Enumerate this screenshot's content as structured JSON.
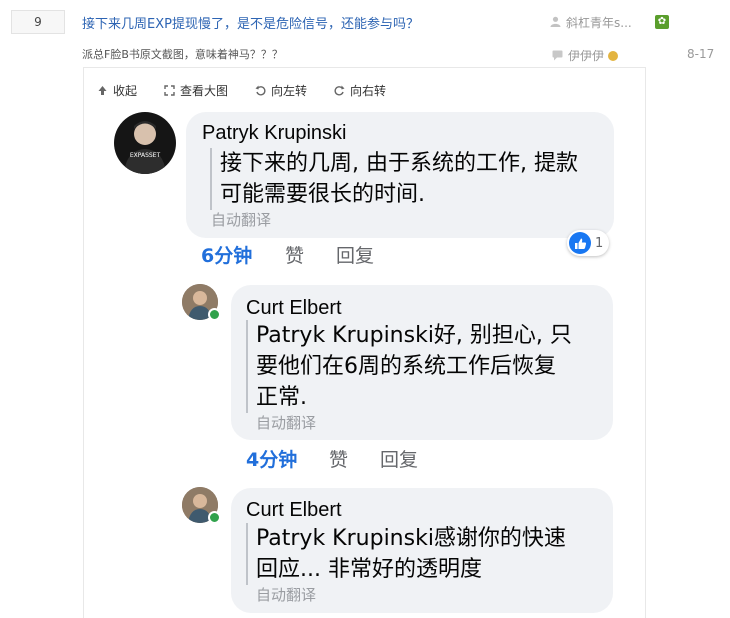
{
  "thread": {
    "reply_count": "9",
    "title": "接下来几周EXP提现慢了，是不是危险信号，还能参与吗？",
    "author": "斜杠青年s...",
    "summary": "派总F脸B书原文截图，意味着神马？？？",
    "last_replier": "伊伊伊",
    "date": "8-17"
  },
  "viewer_toolbar": {
    "collapse": "收起",
    "view_full": "查看大图",
    "rotate_left": "向左转",
    "rotate_right": "向右转"
  },
  "comments": [
    {
      "author": "Patryk Krupinski",
      "avatar_text": "EXPASSET",
      "lines": [
        "接下来的几周, 由于系统的工作, 提款",
        "可能需要很长的时间."
      ],
      "translate": "自动翻译",
      "time": "6分钟",
      "like": "赞",
      "reply": "回复",
      "reactions": "1"
    },
    {
      "author": "Curt Elbert",
      "lines": [
        "Patryk Krupinski好, 别担心, 只",
        "要他们在6周的系统工作后恢复",
        "正常."
      ],
      "translate": "自动翻译",
      "time": "4分钟",
      "like": "赞",
      "reply": "回复"
    },
    {
      "author": "Curt Elbert",
      "lines": [
        "Patryk Krupinski感谢你的快速",
        "回应... 非常好的透明度"
      ],
      "translate": "自动翻译"
    }
  ],
  "colors": {
    "link_blue": "#2d64b3",
    "fb_blue": "#216fdb",
    "bubble_gray": "#f0f2f5",
    "online_green": "#31a24c"
  }
}
